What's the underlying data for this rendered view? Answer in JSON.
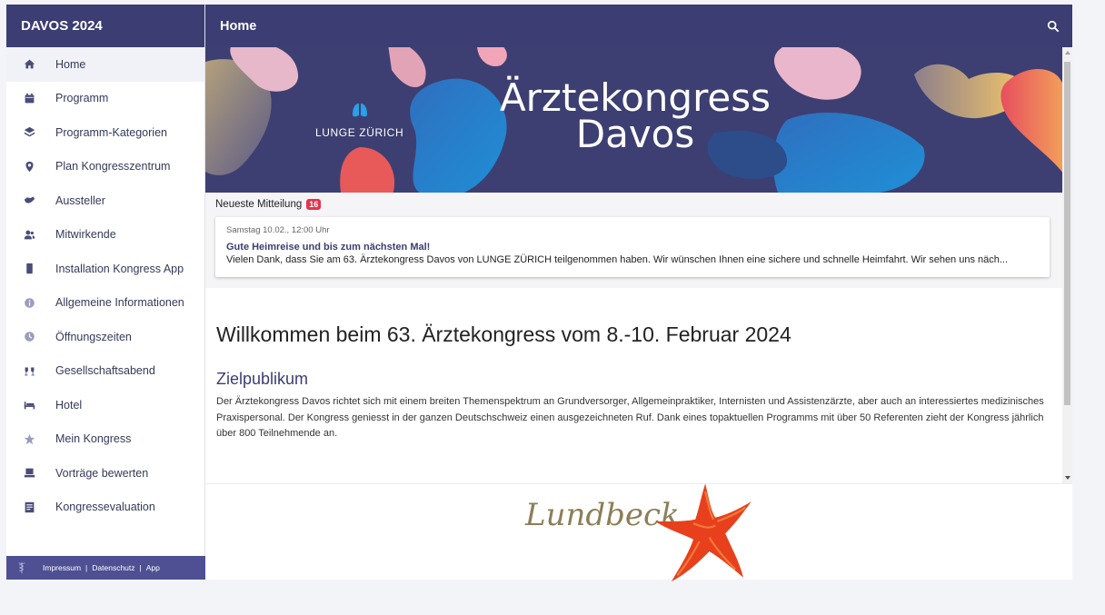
{
  "app": {
    "brand": "DAVOS 2024",
    "page_title": "Home"
  },
  "sidebar": {
    "items": [
      {
        "label": "Home",
        "icon": "home-icon",
        "active": true
      },
      {
        "label": "Programm",
        "icon": "calendar-icon"
      },
      {
        "label": "Programm-Kategorien",
        "icon": "layers-icon"
      },
      {
        "label": "Plan Kongresszentrum",
        "icon": "map-pin-icon"
      },
      {
        "label": "Aussteller",
        "icon": "handshake-icon"
      },
      {
        "label": "Mitwirkende",
        "icon": "people-icon"
      },
      {
        "label": "Installation Kongress App",
        "icon": "phone-icon"
      },
      {
        "label": "Allgemeine Informationen",
        "icon": "info-icon"
      },
      {
        "label": "Öffnungszeiten",
        "icon": "clock-icon"
      },
      {
        "label": "Gesellschaftsabend",
        "icon": "cheers-icon"
      },
      {
        "label": "Hotel",
        "icon": "bed-icon"
      },
      {
        "label": "Mein Kongress",
        "icon": "star-icon"
      },
      {
        "label": "Vorträge bewerten",
        "icon": "rating-icon"
      },
      {
        "label": "Kongressevaluation",
        "icon": "survey-icon"
      }
    ],
    "footer": {
      "impressum": "Impressum",
      "datenschutz": "Datenschutz",
      "app": "App",
      "separator": "|"
    }
  },
  "banner": {
    "logo_text": "LUNGE ZÜRICH",
    "title_line1": "Ärztekongress",
    "title_line2": "Davos"
  },
  "news": {
    "heading": "Neueste Mitteilung",
    "badge": "16",
    "date": "Samstag 10.02., 12:00 Uhr",
    "title": "Gute Heimreise und bis zum nächsten Mal!",
    "text": "Vielen Dank, dass Sie am 63. Ärztekongress Davos von LUNGE ZÜRICH teilgenommen haben. Wir wünschen Ihnen eine sichere und schnelle Heimfahrt. Wir sehen uns näch..."
  },
  "welcome": {
    "heading": "Willkommen beim 63. Ärztekongress vom 8.-10. Februar 2024",
    "subheading": "Zielpublikum",
    "paragraph": "Der Ärztekongress Davos richtet sich mit einem breiten Themenspektrum an Grundversorger, Allgemeinpraktiker, Internisten und Assistenzärzte, aber auch an interessiertes medizinisches Praxispersonal. Der Kongress geniesst in der ganzen Deutschschweiz einen ausgezeichneten Ruf. Dank eines topaktuellen Programms mit über 50 Referenten zieht der Kongress jährlich über 800 Teilnehmende an."
  },
  "sponsor": {
    "name": "Lundbeck"
  },
  "colors": {
    "primary": "#3b3d73",
    "footer": "#4e5093",
    "badge": "#e3344c",
    "sponsor_star": "#e8401c"
  }
}
